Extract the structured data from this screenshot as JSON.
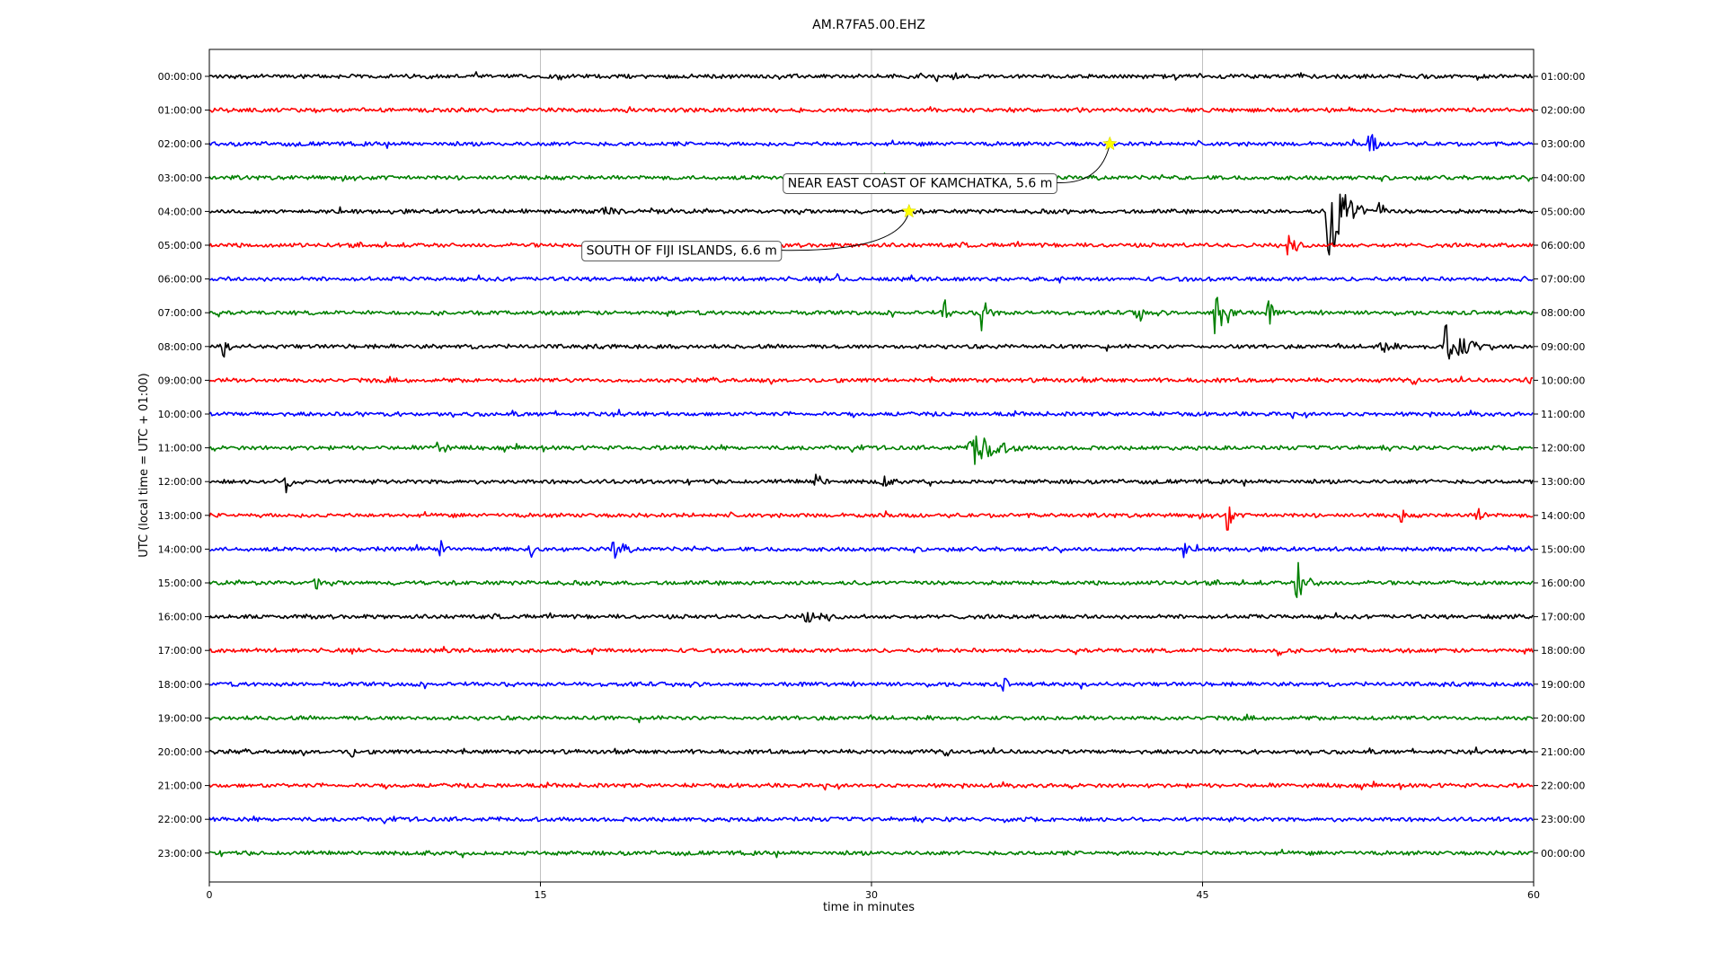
{
  "chart_data": {
    "type": "line",
    "title": "AM.R7FA5.00.EHZ",
    "xlabel": "time in minutes",
    "ylabel": "UTC (local time = UTC + 01:00)",
    "xlim": [
      0,
      60
    ],
    "x_ticks": [
      "0",
      "15",
      "30",
      "45",
      "60"
    ],
    "grid": "vertical at x ticks",
    "series_colors": [
      "#000000",
      "#ff0000",
      "#0000ff",
      "#008000"
    ],
    "marker_color": "#ffff00",
    "rows": [
      {
        "left": "00:00:00",
        "right": "01:00:00",
        "events": [
          {
            "t": 33.0,
            "a": 0.2,
            "d": 0.1
          }
        ]
      },
      {
        "left": "01:00:00",
        "right": "02:00:00",
        "events": []
      },
      {
        "left": "02:00:00",
        "right": "03:00:00",
        "events": [
          {
            "t": 52.6,
            "a": 0.9,
            "d": 0.5
          }
        ]
      },
      {
        "left": "03:00:00",
        "right": "04:00:00",
        "events": []
      },
      {
        "left": "04:00:00",
        "right": "05:00:00",
        "events": [
          {
            "t": 17.8,
            "a": 0.3,
            "d": 1.0
          },
          {
            "t": 50.7,
            "a": 2.6,
            "d": 1.8
          },
          {
            "t": 53.0,
            "a": 0.8,
            "d": 0.4
          }
        ]
      },
      {
        "left": "05:00:00",
        "right": "06:00:00",
        "events": [
          {
            "t": 48.8,
            "a": 0.6,
            "d": 0.8
          }
        ]
      },
      {
        "left": "06:00:00",
        "right": "07:00:00",
        "events": [
          {
            "t": 28.5,
            "a": 0.3,
            "d": 0.3
          },
          {
            "t": 59.5,
            "a": 0.3,
            "d": 0.5
          }
        ]
      },
      {
        "left": "07:00:00",
        "right": "08:00:00",
        "events": [
          {
            "t": 33.3,
            "a": 0.8,
            "d": 0.4
          },
          {
            "t": 35.0,
            "a": 0.8,
            "d": 0.8
          },
          {
            "t": 42.0,
            "a": 0.9,
            "d": 0.5
          },
          {
            "t": 45.6,
            "a": 1.6,
            "d": 1.2
          },
          {
            "t": 48.0,
            "a": 0.6,
            "d": 0.5
          }
        ]
      },
      {
        "left": "08:00:00",
        "right": "09:00:00",
        "events": [
          {
            "t": 0.6,
            "a": 0.4,
            "d": 0.6
          },
          {
            "t": 53.0,
            "a": 0.4,
            "d": 1.0
          },
          {
            "t": 56.0,
            "a": 1.0,
            "d": 2.2
          }
        ]
      },
      {
        "left": "09:00:00",
        "right": "10:00:00",
        "events": [
          {
            "t": 59.7,
            "a": 0.3,
            "d": 0.3
          }
        ]
      },
      {
        "left": "10:00:00",
        "right": "11:00:00",
        "events": []
      },
      {
        "left": "11:00:00",
        "right": "12:00:00",
        "events": [
          {
            "t": 10.4,
            "a": 0.8,
            "d": 0.5
          },
          {
            "t": 34.5,
            "a": 0.9,
            "d": 2.5
          }
        ]
      },
      {
        "left": "12:00:00",
        "right": "13:00:00",
        "events": [
          {
            "t": 3.5,
            "a": 0.5,
            "d": 0.8
          },
          {
            "t": 27.5,
            "a": 0.4,
            "d": 0.6
          },
          {
            "t": 30.5,
            "a": 0.4,
            "d": 0.5
          }
        ]
      },
      {
        "left": "13:00:00",
        "right": "14:00:00",
        "events": [
          {
            "t": 46.1,
            "a": 1.1,
            "d": 0.4
          },
          {
            "t": 54.0,
            "a": 0.4,
            "d": 0.3
          },
          {
            "t": 57.5,
            "a": 0.4,
            "d": 0.5
          }
        ]
      },
      {
        "left": "14:00:00",
        "right": "15:00:00",
        "events": [
          {
            "t": 10.5,
            "a": 0.4,
            "d": 0.4
          },
          {
            "t": 14.6,
            "a": 0.5,
            "d": 0.3
          },
          {
            "t": 18.3,
            "a": 0.6,
            "d": 1.0
          },
          {
            "t": 44.2,
            "a": 0.5,
            "d": 0.3
          }
        ]
      },
      {
        "left": "15:00:00",
        "right": "16:00:00",
        "events": [
          {
            "t": 4.8,
            "a": 0.5,
            "d": 0.3
          },
          {
            "t": 49.3,
            "a": 1.4,
            "d": 0.5
          },
          {
            "t": 50.0,
            "a": 0.6,
            "d": 0.4
          }
        ]
      },
      {
        "left": "16:00:00",
        "right": "17:00:00",
        "events": [
          {
            "t": 27.0,
            "a": 0.4,
            "d": 1.2
          }
        ]
      },
      {
        "left": "17:00:00",
        "right": "18:00:00",
        "events": [
          {
            "t": 48.5,
            "a": 0.4,
            "d": 0.3
          }
        ]
      },
      {
        "left": "18:00:00",
        "right": "19:00:00",
        "events": [
          {
            "t": 36.0,
            "a": 0.4,
            "d": 0.3
          }
        ]
      },
      {
        "left": "19:00:00",
        "right": "20:00:00",
        "events": []
      },
      {
        "left": "20:00:00",
        "right": "21:00:00",
        "events": [
          {
            "t": 6.5,
            "a": 0.4,
            "d": 0.2
          }
        ]
      },
      {
        "left": "21:00:00",
        "right": "22:00:00",
        "events": []
      },
      {
        "left": "22:00:00",
        "right": "23:00:00",
        "events": []
      },
      {
        "left": "23:00:00",
        "right": "00:00:00",
        "events": []
      }
    ],
    "annotations": [
      {
        "text": "NEAR EAST COAST OF KAMCHATKA, 5.6 m",
        "row": 2,
        "t": 40.8,
        "label_row": 3.15,
        "label_t": 32.2
      },
      {
        "text": "SOUTH OF FIJI ISLANDS, 6.6 m",
        "row": 4,
        "t": 31.7,
        "label_row": 5.15,
        "label_t": 21.4
      }
    ]
  }
}
